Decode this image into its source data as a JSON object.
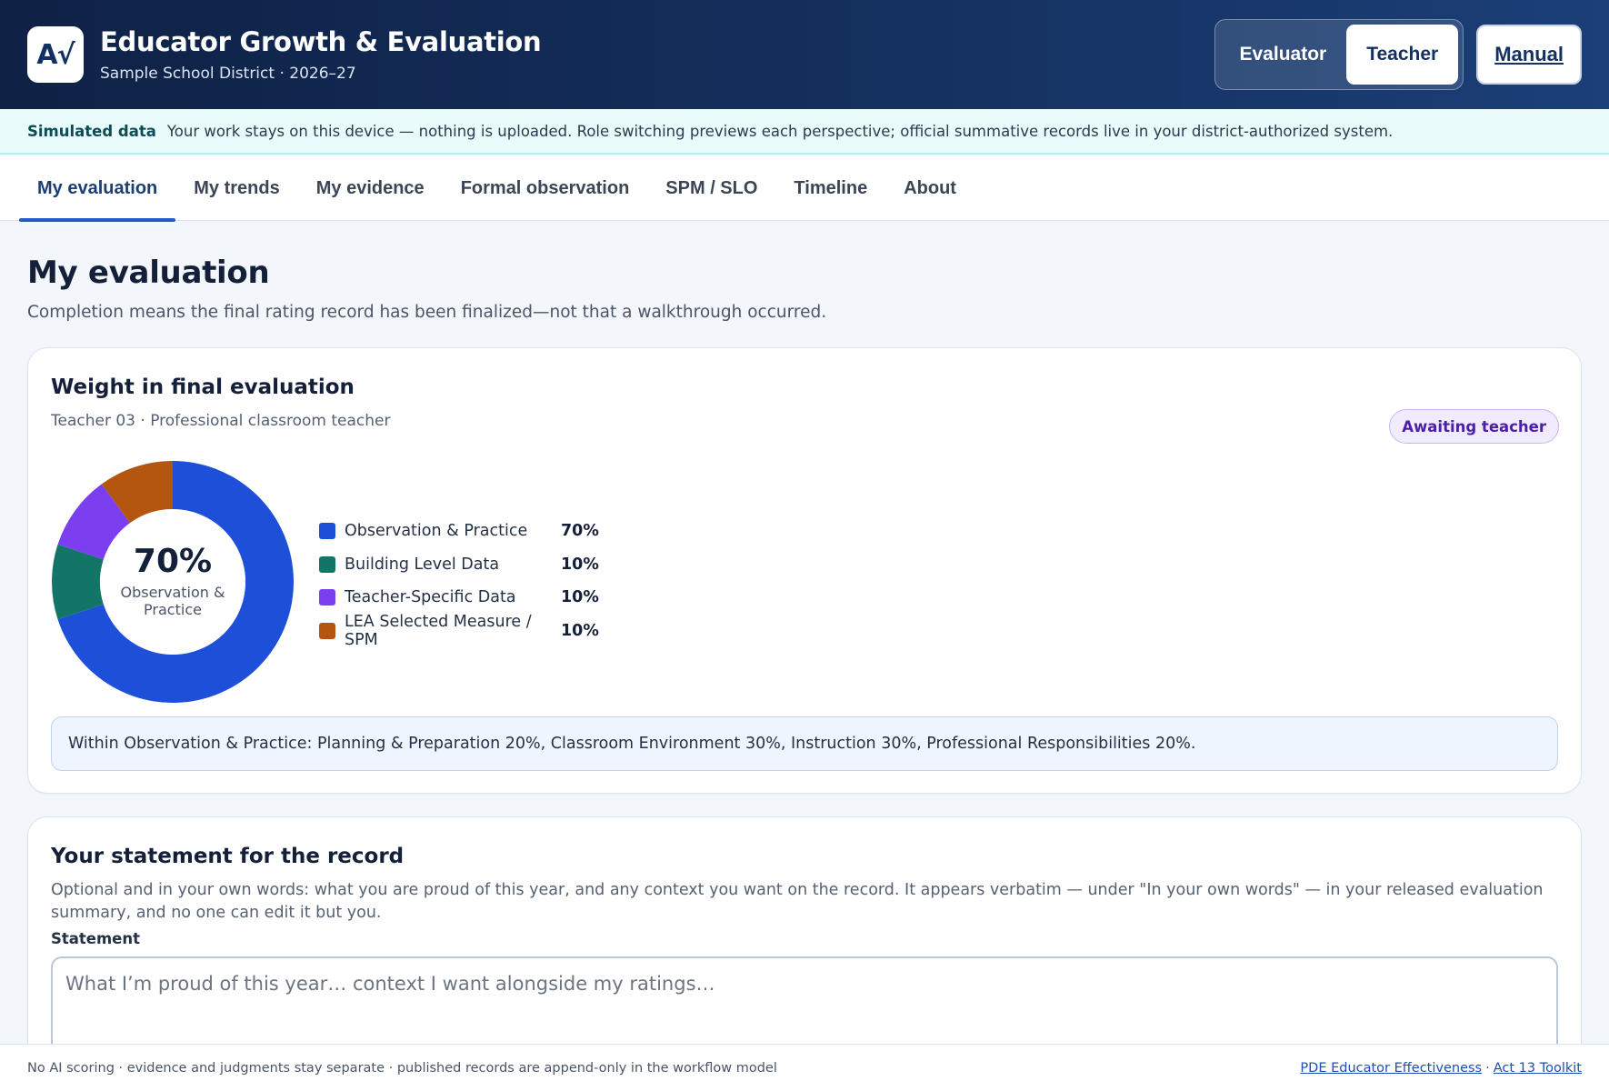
{
  "header": {
    "logo_text": "A√",
    "title": "Educator Growth & Evaluation",
    "subtitle": "Sample School District · 2026–27",
    "roles": [
      "Evaluator",
      "Teacher"
    ],
    "active_role": "Teacher",
    "manual_label": "Manual"
  },
  "banner": {
    "label": "Simulated data",
    "text": "Your work stays on this device — nothing is uploaded. Role switching previews each perspective; official summative records live in your district-authorized system."
  },
  "tabs": [
    {
      "label": "My evaluation",
      "active": true
    },
    {
      "label": "My trends",
      "active": false
    },
    {
      "label": "My evidence",
      "active": false
    },
    {
      "label": "Formal observation",
      "active": false
    },
    {
      "label": "SPM / SLO",
      "active": false
    },
    {
      "label": "Timeline",
      "active": false
    },
    {
      "label": "About",
      "active": false
    }
  ],
  "main": {
    "title": "My evaluation",
    "subtitle": "Completion means the final rating record has been finalized—not that a walkthrough occurred."
  },
  "weight_card": {
    "title": "Weight in final evaluation",
    "subtitle": "Teacher 03 · Professional classroom teacher",
    "status": "Awaiting teacher",
    "center_pct": "70%",
    "center_label": "Observation & Practice",
    "note": "Within Observation & Practice: Planning & Preparation 20%, Classroom Environment 30%, Instruction 30%, Professional Responsibilities 20%."
  },
  "chart_data": {
    "type": "pie",
    "donut": true,
    "categories": [
      "Observation & Practice",
      "Building Level Data",
      "Teacher-Specific Data",
      "LEA Selected Measure / SPM"
    ],
    "values": [
      70,
      10,
      10,
      10
    ],
    "value_labels": [
      "70%",
      "10%",
      "10%",
      "10%"
    ],
    "colors": [
      "#1e4fd8",
      "#137568",
      "#7b3ff0",
      "#b4560f"
    ],
    "legend": "right"
  },
  "statement_card": {
    "title": "Your statement for the record",
    "description": "Optional and in your own words: what you are proud of this year, and any context you want on the record. It appears verbatim — under \"In your own words\" — in your released evaluation summary, and no one can edit it but you.",
    "field_label": "Statement",
    "placeholder": "What I’m proud of this year… context I want alongside my ratings…",
    "value": ""
  },
  "footer": {
    "text": "No AI scoring · evidence and judgments stay separate · published records are append-only in the workflow model",
    "link1": "PDE Educator Effectiveness",
    "separator": "·",
    "link2": "Act 13 Toolkit"
  }
}
